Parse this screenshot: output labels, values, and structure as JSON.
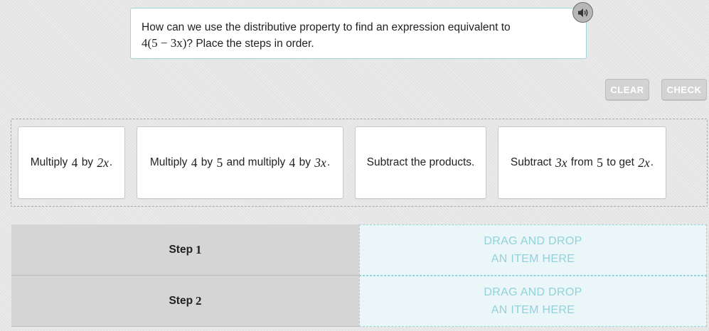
{
  "prompt": {
    "text_before": "How can we use the distributive property to find an expression equivalent to",
    "expression": "4(5 − 3x)",
    "text_after": "? Place the steps in order."
  },
  "audio": {
    "icon": "speaker-icon"
  },
  "buttons": {
    "clear": "CLEAR",
    "check": "CHECK"
  },
  "cards": [
    {
      "pre": "Multiply ",
      "m1": "4",
      "mid1": " by ",
      "m2": "2x",
      "post": "."
    },
    {
      "pre": "Multiply ",
      "m1": "4",
      "mid1": " by ",
      "m2": "5",
      "mid2": " and multiply ",
      "m3": "4",
      "mid3": " by ",
      "m4": "3x",
      "post": "."
    },
    {
      "pre": "Subtract the products."
    },
    {
      "pre": "Subtract ",
      "m1": "3x",
      "mid1": " from ",
      "m2": "5",
      "mid2": " to get ",
      "m3": "2x",
      "post": "."
    }
  ],
  "steps": [
    {
      "label": "Step",
      "number": "1",
      "drop_line1": "DRAG AND DROP",
      "drop_line2": "AN ITEM HERE"
    },
    {
      "label": "Step",
      "number": "2",
      "drop_line1": "DRAG AND DROP",
      "drop_line2": "AN ITEM HERE"
    }
  ],
  "colors": {
    "prompt_border": "#9fd4dc",
    "drop_border": "#93d5dd",
    "drop_text": "#93d1db",
    "button_bg": "#d3d3d3"
  }
}
